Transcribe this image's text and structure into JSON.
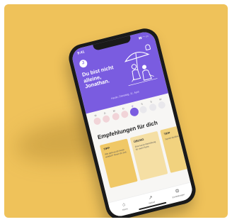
{
  "status": {
    "time": "9:41",
    "signals": "▮▮ ◠ ▭"
  },
  "header": {
    "avatar_initial": "J",
    "greeting": "Du bist nicht alleine, Jonathan.",
    "date_line": "Heute, Dienstag, 11. April"
  },
  "days": [
    {
      "letter": "M",
      "state": "past"
    },
    {
      "letter": "D",
      "state": "past"
    },
    {
      "letter": "M",
      "state": "past"
    },
    {
      "letter": "D",
      "state": "past"
    },
    {
      "letter": "F",
      "state": "selected"
    },
    {
      "letter": "S",
      "state": "future"
    },
    {
      "letter": "S",
      "state": "future"
    },
    {
      "letter": "M",
      "state": "future"
    }
  ],
  "recommendations": {
    "title": "Empfehlungen für dich",
    "cards": [
      {
        "label": "TIPP",
        "text": "Wie geht es dir heute wirklich? Nimm dir Zeit."
      },
      {
        "label": "ÜBUNG",
        "text": "Eine kurze Atemübung für mehr Ruhe."
      },
      {
        "label": "TIPP",
        "text": "Sprich darüber."
      }
    ]
  },
  "nav": [
    {
      "icon": "home-icon",
      "glyph": "⌂",
      "label": "Home"
    },
    {
      "icon": "chart-icon",
      "glyph": "↗",
      "label": "Verlauf"
    },
    {
      "icon": "settings-icon",
      "glyph": "⚙",
      "label": "Einstellungen"
    }
  ],
  "colors": {
    "background": "#efc25a",
    "accent": "#7a5ce0",
    "card_primary": "#f0c866"
  }
}
